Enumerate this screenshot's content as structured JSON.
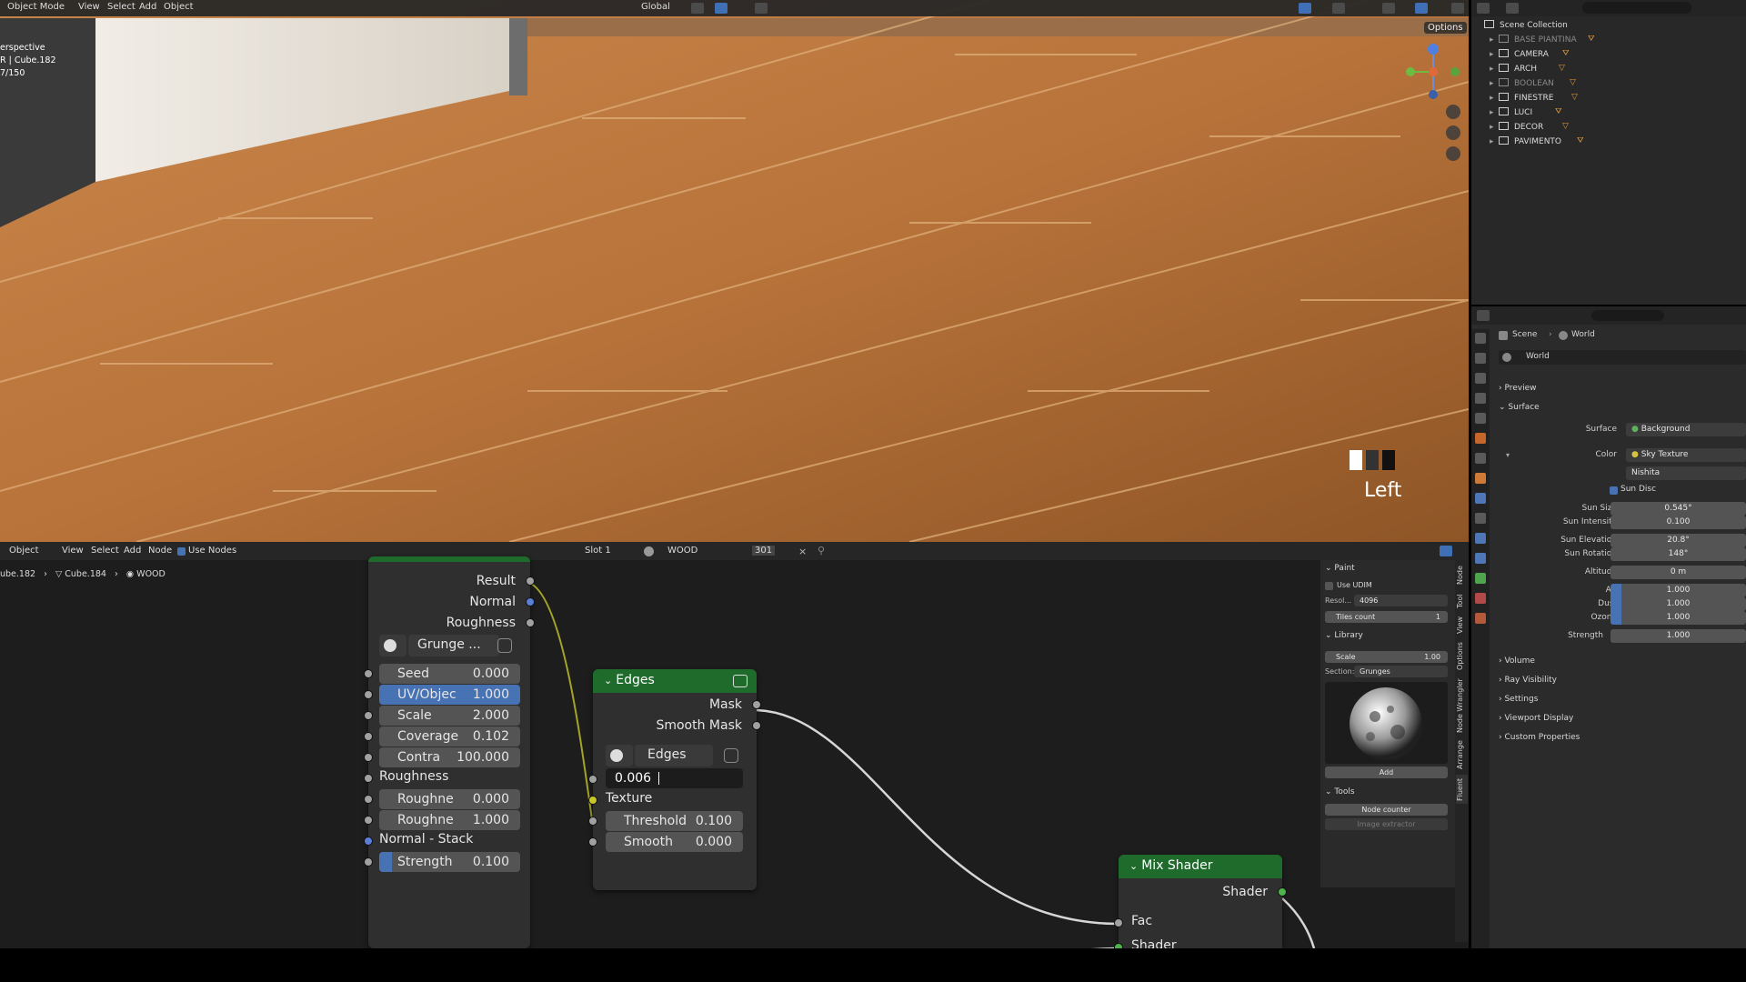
{
  "viewport": {
    "header": {
      "mode": "Object Mode",
      "menus": [
        "View",
        "Select",
        "Add",
        "Object"
      ],
      "orientation": "Global",
      "options": "Options"
    },
    "info_lines": [
      "erspective",
      "R | Cube.182",
      "7/150"
    ],
    "view_label": "Left"
  },
  "outliner": {
    "title": "Scene Collection",
    "items": [
      {
        "label": "BASE PIANTINA",
        "dim": true
      },
      {
        "label": "CAMERA",
        "dim": false
      },
      {
        "label": "ARCH",
        "dim": false
      },
      {
        "label": "BOOLEAN",
        "dim": true
      },
      {
        "label": "FINESTRE",
        "dim": false
      },
      {
        "label": "LUCI",
        "dim": false
      },
      {
        "label": "DECOR",
        "dim": false
      },
      {
        "label": "PAVIMENTO",
        "dim": false
      }
    ]
  },
  "properties": {
    "breadcrumb_scene": "Scene",
    "breadcrumb_world": "World",
    "world_name": "World",
    "sections": {
      "preview": "Preview",
      "surface": "Surface",
      "volume": "Volume",
      "ray_visibility": "Ray Visibility",
      "settings": "Settings",
      "viewport_display": "Viewport Display",
      "custom_properties": "Custom Properties"
    },
    "surface_label": "Surface",
    "surface_value": "Background",
    "color_label": "Color",
    "color_value": "Sky Texture",
    "sky_type": "Nishita",
    "sun_disc": "Sun Disc",
    "rows": [
      {
        "label": "Sun Size",
        "value": "0.545°"
      },
      {
        "label": "Sun Intensity",
        "value": "0.100"
      },
      {
        "label": "Sun Elevation",
        "value": "20.8°"
      },
      {
        "label": "Sun Rotation",
        "value": "148°"
      },
      {
        "label": "Altitude",
        "value": "0 m"
      },
      {
        "label": "Air",
        "value": "1.000"
      },
      {
        "label": "Dust",
        "value": "1.000"
      },
      {
        "label": "Ozone",
        "value": "1.000"
      },
      {
        "label": "Strength",
        "value": "1.000"
      }
    ]
  },
  "node_editor": {
    "header": {
      "mode": "Object",
      "menus": [
        "View",
        "Select",
        "Add",
        "Node"
      ],
      "use_nodes": "Use Nodes",
      "slot": "Slot 1",
      "material": "WOOD",
      "users": "301"
    },
    "breadcrumb": [
      "ube.182",
      "Cube.184",
      "WOOD"
    ],
    "grunge_node": {
      "outputs": [
        "Result",
        "Normal",
        "Roughness"
      ],
      "texture_name": "Grunge ...",
      "fields": [
        {
          "label": "Seed",
          "value": "0.000",
          "selected": false
        },
        {
          "label": "UV/Objec",
          "value": "1.000",
          "selected": true
        },
        {
          "label": "Scale",
          "value": "2.000",
          "selected": false
        },
        {
          "label": "Coverage",
          "value": "0.102",
          "selected": false
        },
        {
          "label": "Contra",
          "value": "100.000",
          "selected": false
        }
      ],
      "roughness_header": "Roughness",
      "roughness_fields": [
        {
          "label": "Roughne",
          "value": "0.000"
        },
        {
          "label": "Roughne",
          "value": "1.000"
        }
      ],
      "normal_header": "Normal - Stack",
      "strength": {
        "label": "Strength",
        "value": "0.100"
      }
    },
    "edges_node": {
      "title": "Edges",
      "outputs": [
        "Mask",
        "Smooth Mask"
      ],
      "texture_name": "Edges",
      "edit_value": "0.006",
      "texture_input": "Texture",
      "fields": [
        {
          "label": "Threshold",
          "value": "0.100"
        },
        {
          "label": "Smooth",
          "value": "0.000"
        }
      ]
    },
    "mix_shader": {
      "title": "Mix Shader",
      "output": "Shader",
      "inputs": [
        "Fac",
        "Shader"
      ]
    },
    "npanel": {
      "paint": "Paint",
      "use_udim": "Use UDIM",
      "resol_label": "Resol...",
      "resol_value": "4096",
      "tiles_label": "Tiles count",
      "tiles_value": "1",
      "library": "Library",
      "scale_label": "Scale",
      "scale_value": "1.00",
      "section_label": "Section:",
      "section_value": "Grunges",
      "add": "Add",
      "tools": "Tools",
      "node_counter": "Node counter",
      "image_extractor": "Image extractor",
      "tabs": [
        "Node",
        "Tool",
        "View",
        "Options",
        "Node Wrangler",
        "Arrange",
        "Fluent"
      ]
    }
  },
  "colors": {
    "selected_field": "#4772b3",
    "node_header_green": "#1f6b2c",
    "socket_yellow": "#c7c729",
    "socket_grey": "#a1a1a1",
    "socket_blue": "#5b7fd8",
    "socket_green": "#4db34d"
  }
}
